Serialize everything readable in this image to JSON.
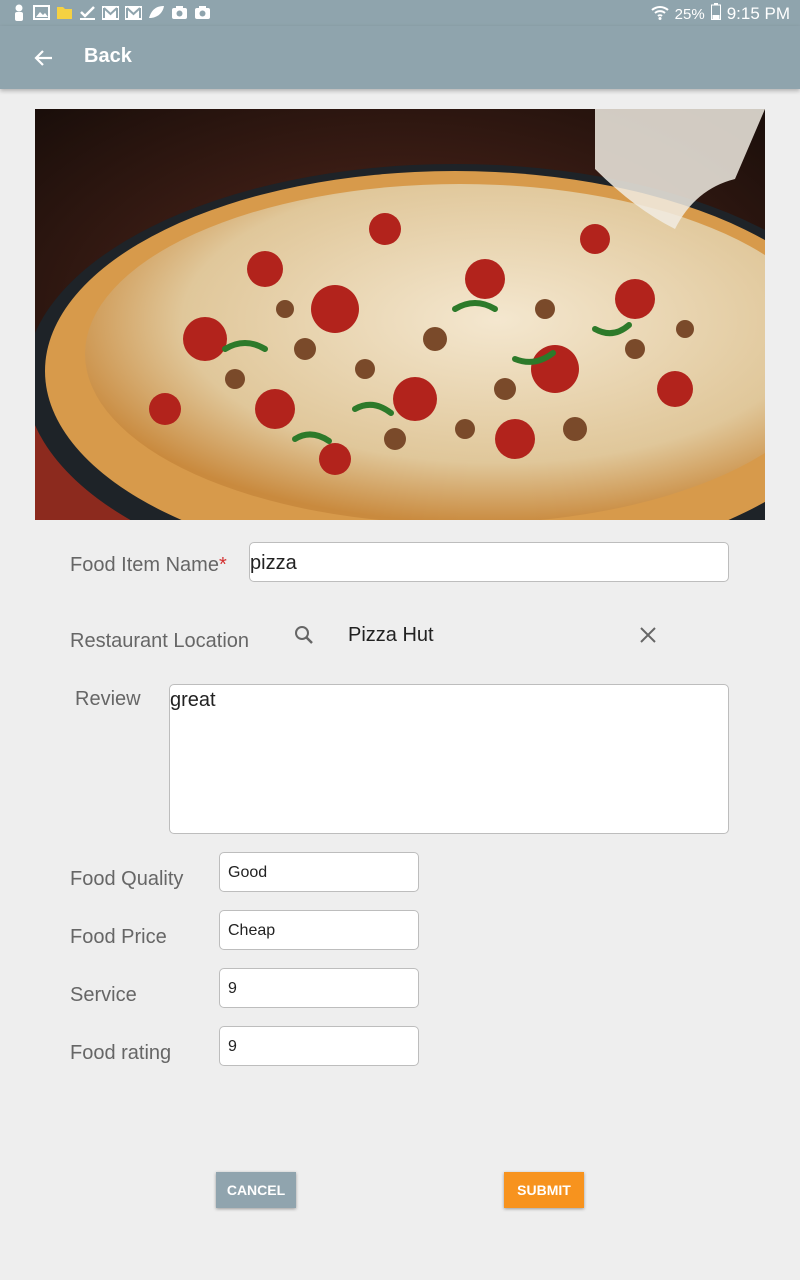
{
  "status_bar": {
    "battery_percent": "25%",
    "time": "9:15 PM",
    "notification_icons": [
      "person-icon",
      "image-icon",
      "file-icon",
      "check-icon",
      "gmail-icon",
      "gmail-icon",
      "leaf-icon",
      "camera-icon",
      "camera-icon"
    ]
  },
  "app_bar": {
    "back_label": "Back"
  },
  "hero": {
    "description_icon": "pizza-photo"
  },
  "form": {
    "food_item_name": {
      "label": "Food Item Name",
      "required_mark": "*",
      "value": "pizza"
    },
    "restaurant_location": {
      "label": "Restaurant Location",
      "value": "Pizza Hut"
    },
    "review": {
      "label": "Review",
      "value": "great"
    },
    "food_quality": {
      "label": "Food Quality",
      "value": "Good"
    },
    "food_price": {
      "label": "Food Price",
      "value": "Cheap"
    },
    "service": {
      "label": "Service",
      "value": "9"
    },
    "food_rating": {
      "label": "Food rating",
      "value": "9"
    }
  },
  "buttons": {
    "cancel": "CANCEL",
    "submit": "SUBMIT"
  },
  "colors": {
    "bar": "#8fa4ad",
    "submit": "#f7931e",
    "cancel": "#90a4ae",
    "required": "#d32f2f"
  }
}
